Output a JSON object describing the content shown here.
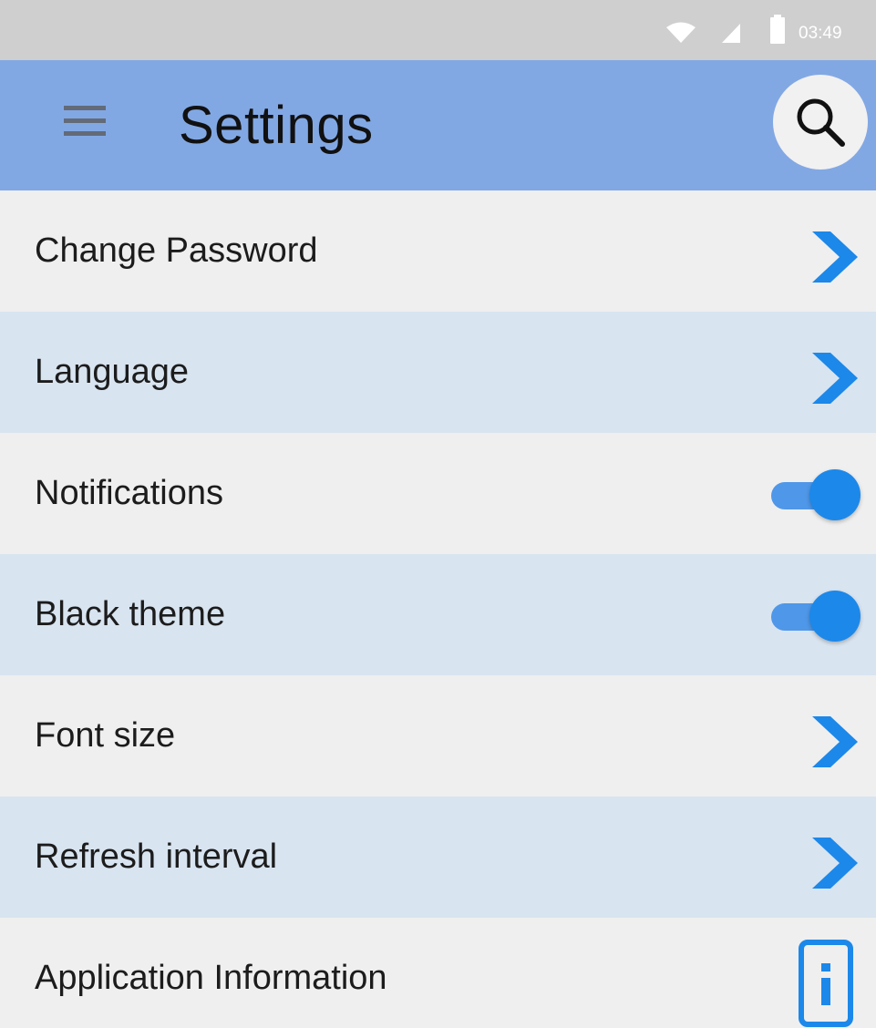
{
  "status_bar": {
    "time": "03:49",
    "icons": [
      "wifi-icon",
      "signal-icon",
      "battery-icon"
    ],
    "color": "#ffffff"
  },
  "app_bar": {
    "title": "Settings",
    "menu_icon": "hamburger-menu-icon",
    "search_icon": "search-icon",
    "background": "#82a8e4"
  },
  "settings": {
    "items": [
      {
        "label": "Change Password",
        "control": "chevron",
        "icon": "chevron-right-icon"
      },
      {
        "label": "Language",
        "control": "chevron",
        "icon": "chevron-right-icon"
      },
      {
        "label": "Notifications",
        "control": "toggle",
        "checked": true
      },
      {
        "label": "Black theme",
        "control": "toggle",
        "checked": true
      },
      {
        "label": "Font size",
        "control": "chevron",
        "icon": "chevron-right-icon"
      },
      {
        "label": "Refresh interval",
        "control": "chevron",
        "icon": "chevron-right-icon"
      },
      {
        "label": "Application Information",
        "control": "info",
        "icon": "info-icon"
      }
    ]
  },
  "colors": {
    "accent": "#1c88ea",
    "row_light": "#efefef",
    "row_alt": "#d8e4f0"
  }
}
